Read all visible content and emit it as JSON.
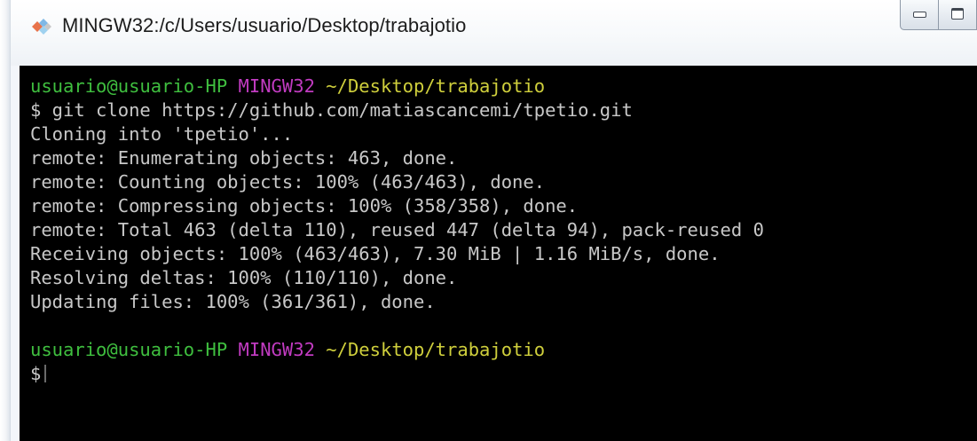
{
  "window": {
    "title": "MINGW32:/c/Users/usuario/Desktop/trabajotio",
    "app_icon": "git-bash-diamond-icon",
    "controls": [
      "minimize-icon",
      "maximize-icon"
    ]
  },
  "colors": {
    "user": "#3fbf3f",
    "host": "#c13bc1",
    "path": "#cfcf3c",
    "output": "#c8c8c8",
    "background": "#000000"
  },
  "terminal": {
    "prompt1": {
      "user": "usuario@usuario-HP",
      "host": "MINGW32",
      "path": "~/Desktop/trabajotio"
    },
    "command": "$ git clone https://github.com/matiascancemi/tpetio.git",
    "output": [
      "Cloning into 'tpetio'...",
      "remote: Enumerating objects: 463, done.",
      "remote: Counting objects: 100% (463/463), done.",
      "remote: Compressing objects: 100% (358/358), done.",
      "remote: Total 463 (delta 110), reused 447 (delta 94), pack-reused 0",
      "Receiving objects: 100% (463/463), 7.30 MiB | 1.16 MiB/s, done.",
      "Resolving deltas: 100% (110/110), done.",
      "Updating files: 100% (361/361), done."
    ],
    "prompt2": {
      "user": "usuario@usuario-HP",
      "host": "MINGW32",
      "path": "~/Desktop/trabajotio"
    },
    "input_prompt": "$"
  }
}
